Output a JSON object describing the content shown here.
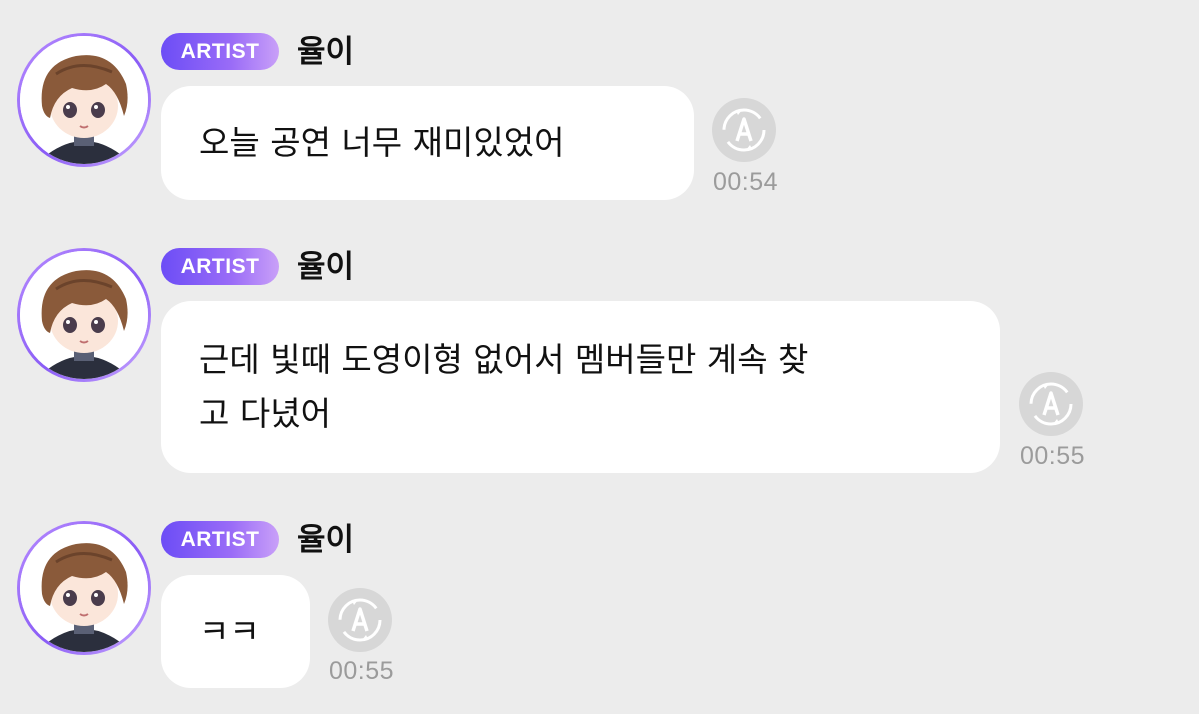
{
  "messages": [
    {
      "badge": "ARTIST",
      "sender": "율이",
      "text": "오늘 공연 너무 재미있었어",
      "time": "00:54"
    },
    {
      "badge": "ARTIST",
      "sender": "율이",
      "text": "근데 빛때 도영이형 없어서 멤버들만 계속 찾\n고 다녔어",
      "time": "00:55"
    },
    {
      "badge": "ARTIST",
      "sender": "율이",
      "text": "ㅋㅋ",
      "time": "00:55"
    }
  ],
  "icons": {
    "translate": "translate-icon",
    "avatar": "avatar-image"
  },
  "colors": {
    "background": "#ececec",
    "bubble": "#ffffff",
    "badge_start": "#6c4df6",
    "badge_end": "#c9a0f8",
    "time": "#9b9b9b"
  }
}
